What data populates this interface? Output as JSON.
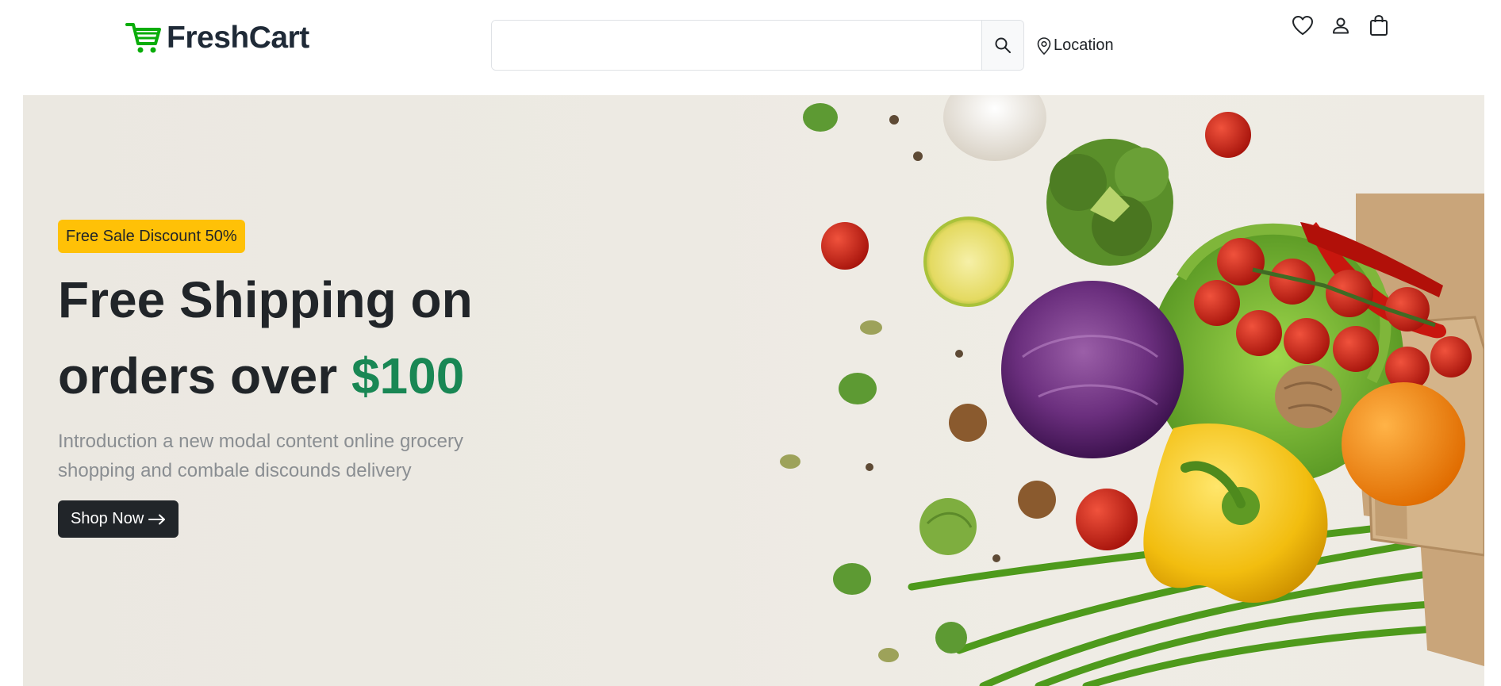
{
  "brand": {
    "name": "FreshCart",
    "color": "#0aad0a"
  },
  "search": {
    "placeholder": "",
    "value": "",
    "icon": "search-icon"
  },
  "location": {
    "label": "Location",
    "icon": "map-pin-icon"
  },
  "header_icons": [
    "heart-icon",
    "user-icon",
    "shopping-bag-icon"
  ],
  "hero": {
    "badge": "Free Sale Discount 50%",
    "headline_part1": "Free Shipping on orders over",
    "headline_accent": "$100",
    "subtext": "Introduction a new modal content online grocery shopping and combale discounds delivery",
    "button_label": "Shop Now",
    "button_icon": "arrow-right-icon",
    "image": "fresh vegetables in paper bag"
  },
  "colors": {
    "badge": "#ffc107",
    "accent": "#198754",
    "button_bg": "#212529",
    "hero_bg": "#edeae3"
  }
}
